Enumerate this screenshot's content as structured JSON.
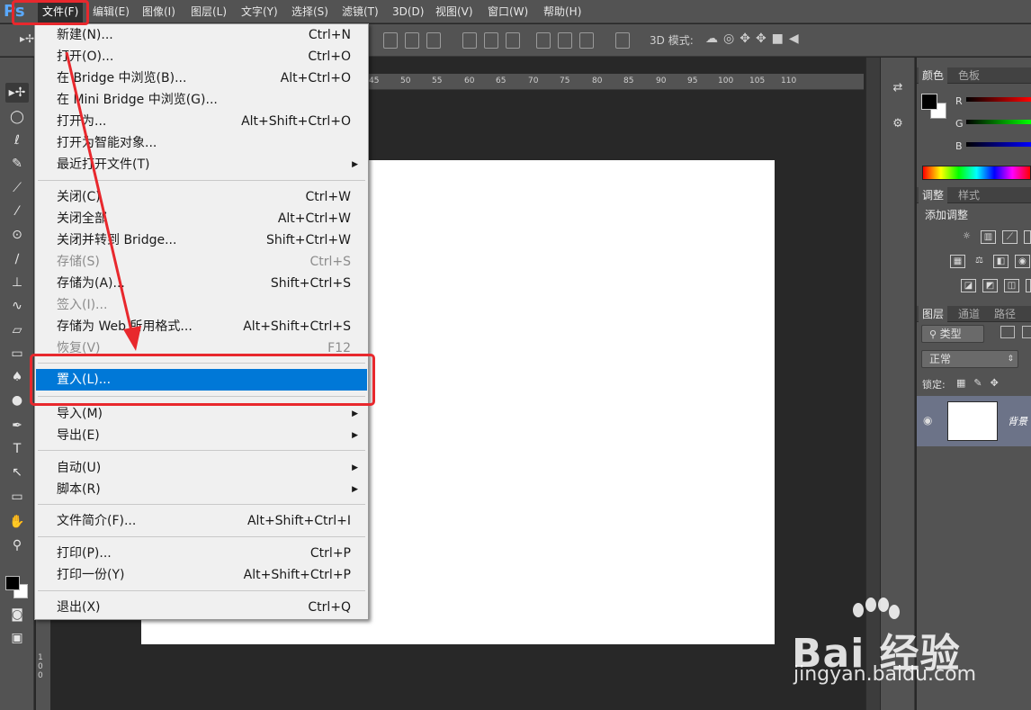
{
  "app": {
    "logo": "Ps"
  },
  "menubar": [
    {
      "label": "文件(F)"
    },
    {
      "label": "编辑(E)"
    },
    {
      "label": "图像(I)"
    },
    {
      "label": "图层(L)"
    },
    {
      "label": "文字(Y)"
    },
    {
      "label": "选择(S)"
    },
    {
      "label": "滤镜(T)"
    },
    {
      "label": "3D(D)"
    },
    {
      "label": "视图(V)"
    },
    {
      "label": "窗口(W)"
    },
    {
      "label": "帮助(H)"
    }
  ],
  "options": {
    "mode3d": "3D 模式:"
  },
  "ruler": {
    "top_ticks": [
      "45",
      "50",
      "55",
      "60",
      "65",
      "70",
      "75",
      "80",
      "85",
      "90",
      "95",
      "100",
      "105",
      "110"
    ],
    "left_label": "100"
  },
  "file_menu": {
    "items": [
      {
        "label": "新建(N)...",
        "shortcut": "Ctrl+N"
      },
      {
        "label": "打开(O)...",
        "shortcut": "Ctrl+O"
      },
      {
        "label": "在 Bridge 中浏览(B)...",
        "shortcut": "Alt+Ctrl+O"
      },
      {
        "label": "在 Mini Bridge 中浏览(G)...",
        "shortcut": ""
      },
      {
        "label": "打开为...",
        "shortcut": "Alt+Shift+Ctrl+O"
      },
      {
        "label": "打开为智能对象...",
        "shortcut": ""
      },
      {
        "label": "最近打开文件(T)",
        "shortcut": ""
      },
      {
        "label": "关闭(C)",
        "shortcut": "Ctrl+W"
      },
      {
        "label": "关闭全部",
        "shortcut": "Alt+Ctrl+W"
      },
      {
        "label": "关闭并转到 Bridge...",
        "shortcut": "Shift+Ctrl+W"
      },
      {
        "label": "存储(S)",
        "shortcut": "Ctrl+S"
      },
      {
        "label": "存储为(A)...",
        "shortcut": "Shift+Ctrl+S"
      },
      {
        "label": "签入(I)...",
        "shortcut": ""
      },
      {
        "label": "存储为 Web 所用格式...",
        "shortcut": "Alt+Shift+Ctrl+S"
      },
      {
        "label": "恢复(V)",
        "shortcut": "F12"
      },
      {
        "label": "置入(L)...",
        "shortcut": ""
      },
      {
        "label": "导入(M)",
        "shortcut": ""
      },
      {
        "label": "导出(E)",
        "shortcut": ""
      },
      {
        "label": "自动(U)",
        "shortcut": ""
      },
      {
        "label": "脚本(R)",
        "shortcut": ""
      },
      {
        "label": "文件简介(F)...",
        "shortcut": "Alt+Shift+Ctrl+I"
      },
      {
        "label": "打印(P)...",
        "shortcut": "Ctrl+P"
      },
      {
        "label": "打印一份(Y)",
        "shortcut": "Alt+Shift+Ctrl+P"
      },
      {
        "label": "退出(X)",
        "shortcut": "Ctrl+Q"
      }
    ]
  },
  "panels": {
    "color_tabs": [
      "颜色",
      "色板"
    ],
    "channels": [
      "R",
      "G",
      "B"
    ],
    "adjust_tabs": [
      "调整",
      "样式"
    ],
    "add_adjustment": "添加调整",
    "layer_tabs": [
      "图层",
      "通道",
      "路径"
    ],
    "filter_type": "类型",
    "blend_mode": "正常",
    "lock_label": "锁定:",
    "layer_name": "背景"
  },
  "watermark": {
    "brand": "Bai 经验",
    "url": "jingyan.baidu.com"
  },
  "colors": {
    "accent": "#0078d7",
    "annotation": "#e8282d"
  }
}
